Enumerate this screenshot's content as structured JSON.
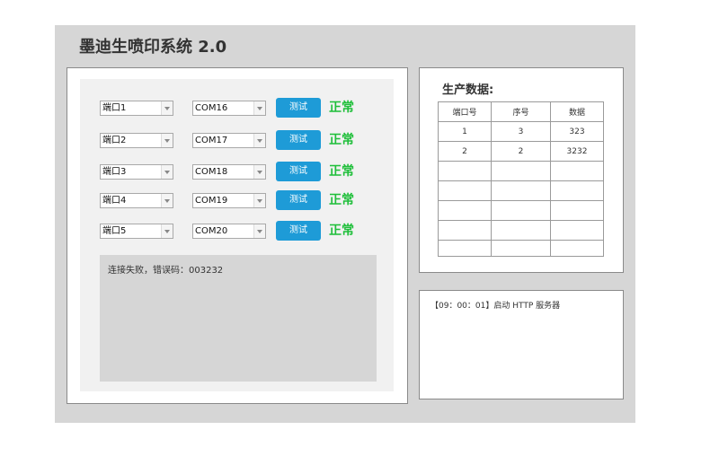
{
  "app": {
    "title": "墨迪生喷印系统 2.0"
  },
  "ports": [
    {
      "port": "端口1",
      "com": "COM16",
      "button": "测试",
      "status": "正常"
    },
    {
      "port": "端口2",
      "com": "COM17",
      "button": "测试",
      "status": "正常"
    },
    {
      "port": "端口3",
      "com": "COM18",
      "button": "测试",
      "status": "正常"
    },
    {
      "port": "端口4",
      "com": "COM19",
      "button": "测试",
      "status": "正常"
    },
    {
      "port": "端口5",
      "com": "COM20",
      "button": "测试",
      "status": "正常"
    }
  ],
  "log": {
    "message": "连接失败，错误码：003232"
  },
  "production": {
    "title": "生产数据:",
    "headers": [
      "端口号",
      "序号",
      "数据"
    ],
    "rows": [
      [
        "1",
        "3",
        "323"
      ],
      [
        "2",
        "2",
        "3232"
      ],
      [
        "",
        "",
        ""
      ],
      [
        "",
        "",
        ""
      ],
      [
        "",
        "",
        ""
      ],
      [
        "",
        "",
        ""
      ],
      [
        "",
        "",
        ""
      ]
    ]
  },
  "system_log": {
    "line": "【09：00：01】启动 HTTP 服务器"
  },
  "colors": {
    "button": "#1e9bd7",
    "status_ok": "#1fbf3a",
    "app_bg": "#d6d6d6"
  }
}
